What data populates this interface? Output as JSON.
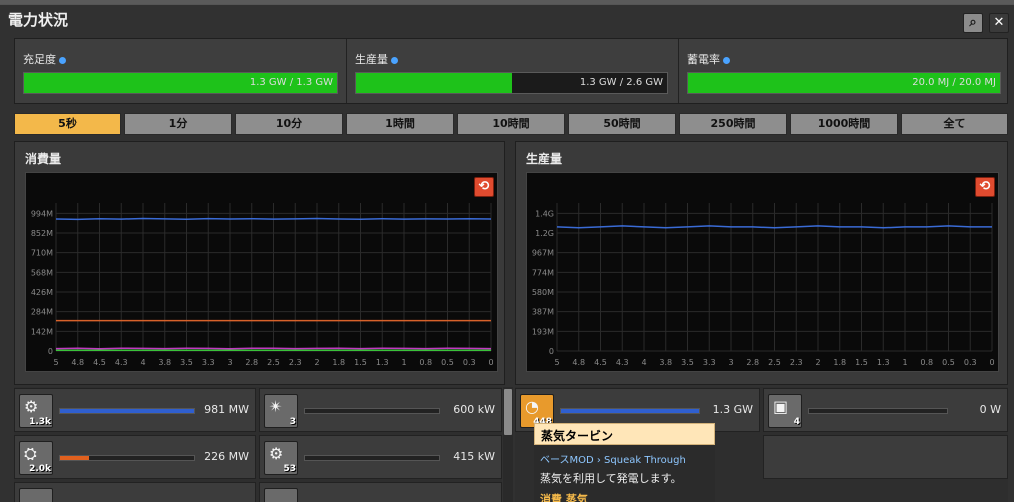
{
  "window": {
    "title": "電力状況"
  },
  "buttons": {
    "search_glyph": "⌕",
    "close_glyph": "✕",
    "reset_glyph": "⟲"
  },
  "stats": [
    {
      "label": "充足度",
      "value": "1.3 GW / 1.3 GW",
      "fill": 1.0
    },
    {
      "label": "生産量",
      "value": "1.3 GW / 2.6 GW",
      "fill": 0.5
    },
    {
      "label": "蓄電率",
      "value": "20.0 MJ / 20.0 MJ",
      "fill": 1.0
    }
  ],
  "time_tabs": [
    "5秒",
    "1分",
    "10分",
    "1時間",
    "10時間",
    "50時間",
    "250時間",
    "1000時間",
    "全て"
  ],
  "active_tab": 0,
  "consumption": {
    "title": "消費量"
  },
  "production": {
    "title": "生産量"
  },
  "chart_data": [
    {
      "type": "line",
      "title": "消費量",
      "x_ticks": [
        "5",
        "4.8",
        "4.5",
        "4.3",
        "4",
        "3.8",
        "3.5",
        "3.3",
        "3",
        "2.8",
        "2.5",
        "2.3",
        "2",
        "1.8",
        "1.5",
        "1.3",
        "1",
        "0.8",
        "0.5",
        "0.3",
        "0"
      ],
      "y_ticks": [
        "0",
        "142M",
        "284M",
        "426M",
        "568M",
        "710M",
        "852M",
        "994M"
      ],
      "ylim": [
        0,
        1100
      ],
      "series": [
        {
          "color": "#3a6bd6",
          "values": [
            981,
            978,
            983,
            980,
            985,
            982,
            979,
            984,
            981,
            983,
            980,
            982,
            985,
            981,
            979,
            983,
            980,
            982,
            981,
            983,
            981
          ]
        },
        {
          "color": "#d8622a",
          "values": [
            226,
            226,
            226,
            226,
            226,
            226,
            226,
            226,
            226,
            226,
            226,
            226,
            226,
            226,
            226,
            226,
            226,
            226,
            226,
            226,
            226
          ]
        },
        {
          "color": "#c23ac2",
          "values": [
            18,
            20,
            17,
            21,
            19,
            18,
            20,
            19,
            17,
            21,
            20,
            18,
            19,
            21,
            18,
            20,
            19,
            18,
            20,
            19,
            18
          ]
        },
        {
          "color": "#3ac23a",
          "values": [
            6,
            6,
            6,
            6,
            6,
            6,
            6,
            6,
            6,
            6,
            6,
            6,
            6,
            6,
            6,
            6,
            6,
            6,
            6,
            6,
            6
          ]
        }
      ]
    },
    {
      "type": "line",
      "title": "生産量",
      "x_ticks": [
        "5",
        "4.8",
        "4.5",
        "4.3",
        "4",
        "3.8",
        "3.5",
        "3.3",
        "3",
        "2.8",
        "2.5",
        "2.3",
        "2",
        "1.8",
        "1.5",
        "1.3",
        "1",
        "0.8",
        "0.5",
        "0.3",
        "0"
      ],
      "y_ticks": [
        "0",
        "193M",
        "387M",
        "580M",
        "774M",
        "967M",
        "1.2G",
        "1.4G"
      ],
      "ylim": [
        0,
        1.55
      ],
      "series": [
        {
          "color": "#3a6bd6",
          "values": [
            1.3,
            1.29,
            1.3,
            1.31,
            1.3,
            1.29,
            1.3,
            1.31,
            1.3,
            1.3,
            1.29,
            1.3,
            1.31,
            1.3,
            1.3,
            1.29,
            1.3,
            1.3,
            1.31,
            1.3,
            1.3
          ]
        }
      ]
    }
  ],
  "consumers": [
    {
      "count": "1.3k",
      "glyph": "⚙",
      "value": "981 MW",
      "fill": 1.0,
      "color": "#2f5fcf"
    },
    {
      "count": "3",
      "glyph": "✴",
      "value": "600 kW",
      "fill": 0.0,
      "color": "#2f5fcf"
    },
    {
      "count": "2.0k",
      "glyph": "⛭",
      "value": "226 MW",
      "fill": 0.22,
      "color": "#e0601e"
    },
    {
      "count": "53",
      "glyph": "⚙",
      "value": "415 kW",
      "fill": 0.0,
      "color": "#2f5fcf"
    }
  ],
  "producers": [
    {
      "count": "448",
      "glyph": "◔",
      "value": "1.3 GW",
      "fill": 1.0,
      "color": "#2f5fcf"
    },
    {
      "count": "4",
      "glyph": "▣",
      "value": "0 W",
      "fill": 0.0,
      "color": "#2f5fcf"
    }
  ],
  "tooltip": {
    "title": "蒸気タービン",
    "mod": "ベースMOD › Squeak Through",
    "description": "蒸気を利用して発電します。",
    "footer": "消費 蒸気"
  }
}
